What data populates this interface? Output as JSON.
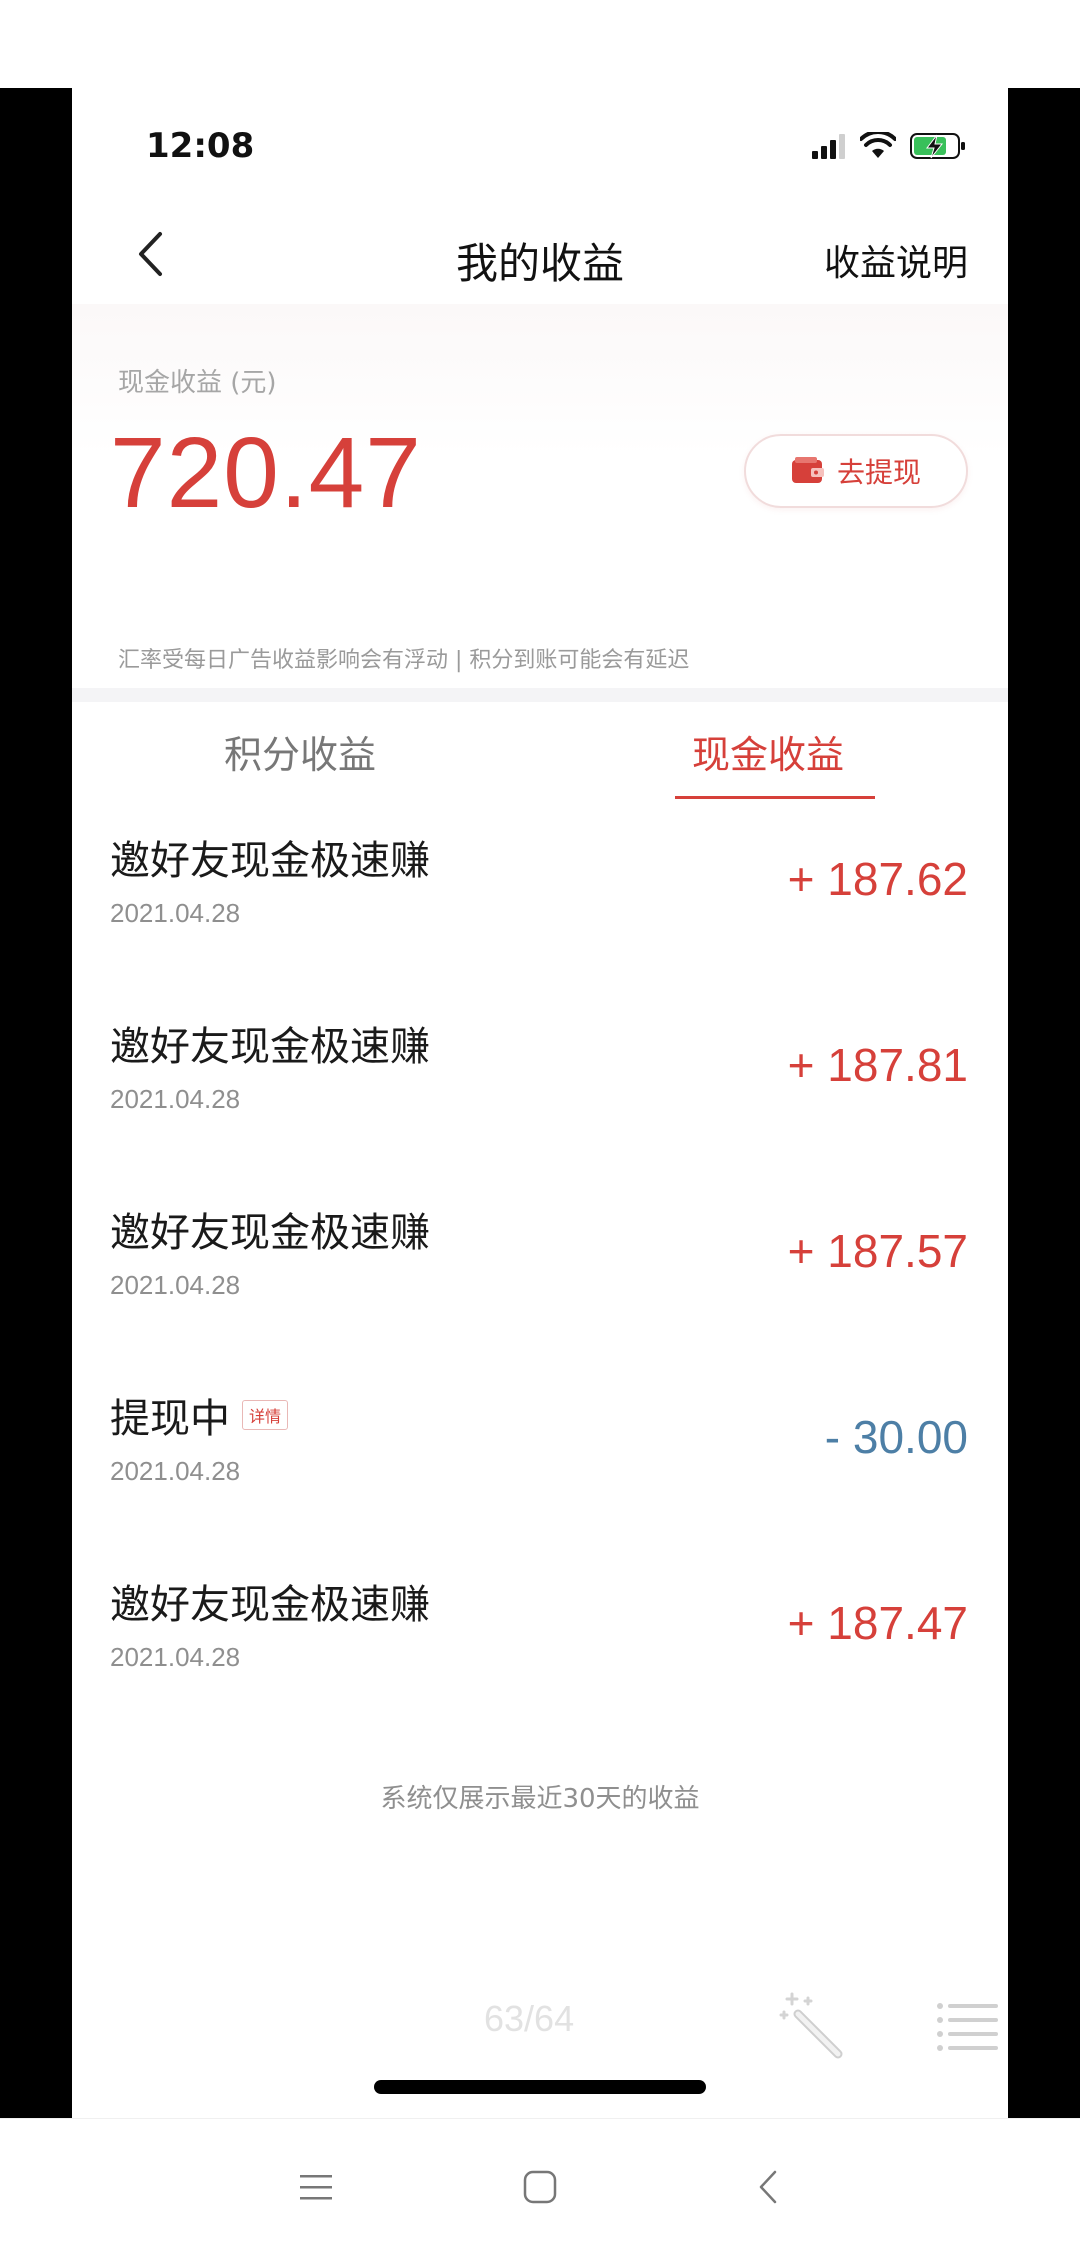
{
  "status_bar": {
    "time": "12:08"
  },
  "header": {
    "title": "我的收益",
    "help_link": "收益说明"
  },
  "summary": {
    "label": "现金收益 (元)",
    "amount": "720.47",
    "withdraw_button": "去提现",
    "note": "汇率受每日广告收益影响会有浮动  |  积分到账可能会有延迟"
  },
  "tabs": [
    {
      "label": "积分收益",
      "active": false
    },
    {
      "label": "现金收益",
      "active": true
    }
  ],
  "records": [
    {
      "title": "邀好友现金极速赚",
      "date": "2021.04.28",
      "amount": "+ 187.62"
    },
    {
      "title": "邀好友现金极速赚",
      "date": "2021.04.28",
      "amount": "+ 187.81"
    },
    {
      "title": "邀好友现金极速赚",
      "date": "2021.04.28",
      "amount": "+ 187.57"
    },
    {
      "title": "提现中",
      "badge": "详情",
      "date": "2021.04.28",
      "amount": "- 30.00"
    },
    {
      "title": "邀好友现金极速赚",
      "date": "2021.04.28",
      "amount": "+ 187.47"
    }
  ],
  "footer_note": "系统仅展示最近30天的收益",
  "overlay": {
    "page_counter": "63/64"
  },
  "colors": {
    "accent_red": "#d6403a",
    "negative_blue": "#4d7fa6"
  }
}
